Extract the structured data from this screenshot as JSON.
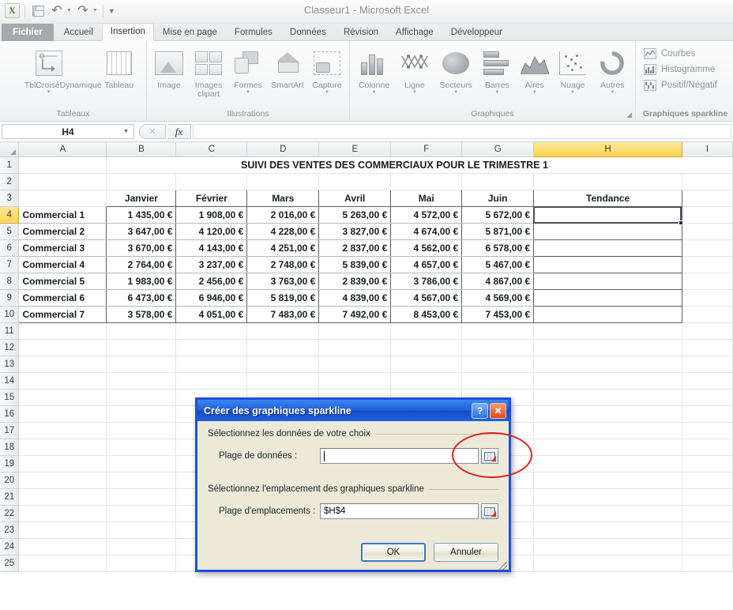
{
  "window": {
    "title": "Classeur1  -  Microsoft Excel",
    "quick_access": {
      "excel_icon": "excel-logo-icon",
      "save_icon": "save-icon",
      "undo_icon": "undo-icon",
      "redo_icon": "redo-icon",
      "customize_icon": "customize-toolbar-icon"
    }
  },
  "ribbon": {
    "tabs": [
      {
        "label": "Fichier",
        "state": "file"
      },
      {
        "label": "Accueil",
        "state": "normal"
      },
      {
        "label": "Insertion",
        "state": "active"
      },
      {
        "label": "Mise en page",
        "state": "normal"
      },
      {
        "label": "Formules",
        "state": "normal"
      },
      {
        "label": "Données",
        "state": "normal"
      },
      {
        "label": "Révision",
        "state": "normal"
      },
      {
        "label": "Affichage",
        "state": "normal"
      },
      {
        "label": "Développeur",
        "state": "normal"
      }
    ],
    "groups": [
      {
        "name": "Tableaux",
        "items": [
          {
            "label": "TblCroiséDynamique",
            "icon": "pivot-table-icon",
            "has_dropdown": true
          },
          {
            "label": "Tableau",
            "icon": "table-icon",
            "has_dropdown": false
          }
        ]
      },
      {
        "name": "Illustrations",
        "items": [
          {
            "label": "Image",
            "icon": "picture-icon",
            "has_dropdown": false
          },
          {
            "label": "Images clipart",
            "icon": "clipart-icon",
            "has_dropdown": false
          },
          {
            "label": "Formes",
            "icon": "shapes-icon",
            "has_dropdown": true
          },
          {
            "label": "SmartArt",
            "icon": "smartart-icon",
            "has_dropdown": false
          },
          {
            "label": "Capture",
            "icon": "screenshot-icon",
            "has_dropdown": true
          }
        ]
      },
      {
        "name": "Graphiques",
        "items": [
          {
            "label": "Colonne",
            "icon": "column-chart-icon",
            "has_dropdown": true
          },
          {
            "label": "Ligne",
            "icon": "line-chart-icon",
            "has_dropdown": true
          },
          {
            "label": "Secteurs",
            "icon": "pie-chart-icon",
            "has_dropdown": true
          },
          {
            "label": "Barres",
            "icon": "bar-chart-icon",
            "has_dropdown": true
          },
          {
            "label": "Aires",
            "icon": "area-chart-icon",
            "has_dropdown": true
          },
          {
            "label": "Nuage",
            "icon": "scatter-chart-icon",
            "has_dropdown": true
          },
          {
            "label": "Autres",
            "icon": "other-charts-icon",
            "has_dropdown": true
          }
        ],
        "dialog_launcher": true
      },
      {
        "name": "Graphiques sparkline",
        "items": [
          {
            "label": "Courbes",
            "icon": "sparkline-line-icon"
          },
          {
            "label": "Histogramme",
            "icon": "sparkline-column-icon"
          },
          {
            "label": "Positif/Négatif",
            "icon": "sparkline-winloss-icon"
          }
        ]
      }
    ]
  },
  "formula_bar": {
    "name_box": "H4",
    "formula": "",
    "fx_label": "fx",
    "cancel_icon": "formula-cancel-icon",
    "fx_icon": "insert-function-icon"
  },
  "sheet": {
    "columns": [
      "A",
      "B",
      "C",
      "D",
      "E",
      "F",
      "G",
      "H",
      "I"
    ],
    "selected_column": "H",
    "selected_cell": "H4",
    "rows": [
      1,
      2,
      3,
      4,
      5,
      6,
      7,
      8,
      9,
      10,
      11,
      12,
      13,
      14,
      15,
      16,
      17,
      18,
      19,
      20,
      21,
      22,
      23,
      24,
      25
    ],
    "title_row": {
      "row": 1,
      "text": "SUIVI DES VENTES DES COMMERCIAUX POUR LE TRIMESTRE 1"
    },
    "headers": {
      "row": 3,
      "labels": [
        "Janvier",
        "Février",
        "Mars",
        "Avril",
        "Mai",
        "Juin",
        "Tendance"
      ]
    },
    "data": [
      {
        "row": 4,
        "name": "Commercial 1",
        "values": [
          "1 435,00 €",
          "1 908,00 €",
          "2 016,00 €",
          "5 263,00 €",
          "4 572,00 €",
          "5 672,00 €"
        ],
        "tendance": ""
      },
      {
        "row": 5,
        "name": "Commercial 2",
        "values": [
          "3 647,00 €",
          "4 120,00 €",
          "4 228,00 €",
          "3 827,00 €",
          "4 674,00 €",
          "5 871,00 €"
        ],
        "tendance": ""
      },
      {
        "row": 6,
        "name": "Commercial 3",
        "values": [
          "3 670,00 €",
          "4 143,00 €",
          "4 251,00 €",
          "2 837,00 €",
          "4 562,00 €",
          "6 578,00 €"
        ],
        "tendance": ""
      },
      {
        "row": 7,
        "name": "Commercial 4",
        "values": [
          "2 764,00 €",
          "3 237,00 €",
          "2 748,00 €",
          "5 839,00 €",
          "4 657,00 €",
          "5 467,00 €"
        ],
        "tendance": ""
      },
      {
        "row": 8,
        "name": "Commercial 5",
        "values": [
          "1 983,00 €",
          "2 456,00 €",
          "3 763,00 €",
          "2 839,00 €",
          "3 786,00 €",
          "4 867,00 €"
        ],
        "tendance": ""
      },
      {
        "row": 9,
        "name": "Commercial 6",
        "values": [
          "6 473,00 €",
          "6 946,00 €",
          "5 819,00 €",
          "4 839,00 €",
          "4 567,00 €",
          "4 569,00 €"
        ],
        "tendance": ""
      },
      {
        "row": 10,
        "name": "Commercial 7",
        "values": [
          "3 578,00 €",
          "4 051,00 €",
          "7 483,00 €",
          "7 492,00 €",
          "8 453,00 €",
          "7 453,00 €"
        ],
        "tendance": ""
      }
    ]
  },
  "dialog": {
    "title": "Créer des graphiques sparkline",
    "help_button": "?",
    "close_button": "✕",
    "section1_label": "Sélectionnez les données de votre choix",
    "data_range_label": "Plage de données :",
    "data_range_value": "",
    "data_range_picker_icon": "range-picker-icon",
    "section2_label": "Sélectionnez l'emplacement des graphiques sparkline",
    "location_range_label": "Plage d'emplacements :",
    "location_range_value": "$H$4",
    "location_range_picker_icon": "range-picker-icon",
    "ok_label": "OK",
    "cancel_label": "Annuler"
  },
  "annotation": {
    "shape": "red-ellipse-highlight",
    "color": "#e02121"
  }
}
